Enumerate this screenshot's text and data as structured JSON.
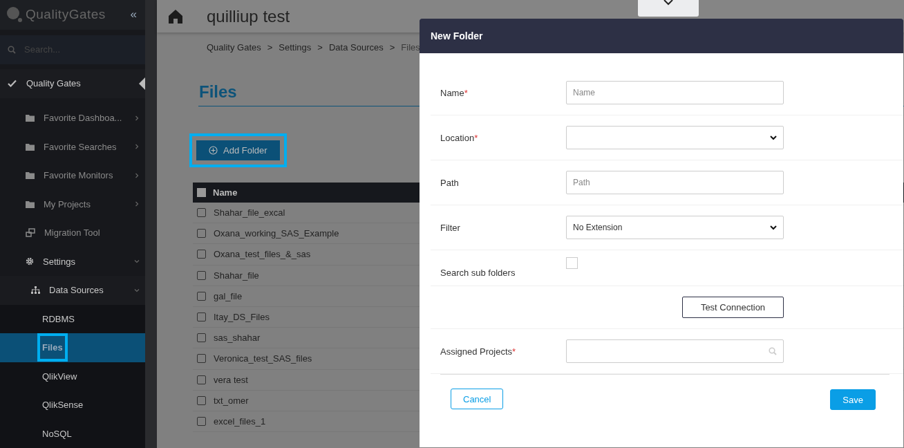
{
  "sidebar": {
    "logo": "QualityGates",
    "collapse": "«",
    "search": {
      "placeholder": "Search..."
    },
    "section": {
      "label": "Quality Gates",
      "expanded": true,
      "children": [
        {
          "label": "Favorite Dashboa...",
          "kind": "folder",
          "expanded": false
        },
        {
          "label": "Favorite Searches",
          "kind": "folder",
          "expanded": false
        },
        {
          "label": "Favorite Monitors",
          "kind": "folder",
          "expanded": false
        },
        {
          "label": "My Projects",
          "kind": "folder",
          "expanded": false
        },
        {
          "label": "Migration Tool",
          "kind": "tool"
        },
        {
          "label": "Settings",
          "kind": "settings",
          "expanded": true,
          "children": [
            {
              "label": "Data Sources",
              "kind": "hierarchy",
              "expanded": true,
              "children": [
                {
                  "label": "RDBMS",
                  "selected": false,
                  "highlighted": false
                },
                {
                  "label": "Files",
                  "selected": true,
                  "highlighted": true
                },
                {
                  "label": "QlikView",
                  "selected": false,
                  "highlighted": false
                },
                {
                  "label": "QlikSense",
                  "selected": false,
                  "highlighted": false
                },
                {
                  "label": "NoSQL",
                  "selected": false,
                  "highlighted": false
                }
              ]
            }
          ]
        }
      ]
    }
  },
  "header": {
    "title": "quilliup test"
  },
  "breadcrumb": {
    "separator": ">",
    "items": [
      "Quality Gates",
      "Settings",
      "Data Sources",
      "Files"
    ]
  },
  "page_title": "Files",
  "add_button": {
    "label": "Add Folder",
    "highlighted": true
  },
  "table": {
    "columns": [
      "Name"
    ],
    "header_checked": false,
    "rows": [
      {
        "name": "Shahar_file_excal",
        "checked": false
      },
      {
        "name": "Oxana_working_SAS_Example",
        "checked": false
      },
      {
        "name": "Oxana_test_files_&_sas",
        "checked": false
      },
      {
        "name": "Shahar_file",
        "checked": false
      },
      {
        "name": "gal_file",
        "checked": false
      },
      {
        "name": "Itay_DS_Files",
        "checked": false
      },
      {
        "name": "sas_shahar",
        "checked": false
      },
      {
        "name": "Veronica_test_SAS_files",
        "checked": false
      },
      {
        "name": "vera test",
        "checked": false
      },
      {
        "name": "txt_omer",
        "checked": false
      },
      {
        "name": "excel_files_1",
        "checked": false
      }
    ]
  },
  "modal": {
    "title": "New Folder",
    "required_mark": "*",
    "fields": [
      {
        "kind": "text",
        "label": "Name",
        "required": true,
        "placeholder": "Name"
      },
      {
        "kind": "select",
        "label": "Location",
        "required": true
      },
      {
        "kind": "text",
        "label": "Path",
        "required": false,
        "placeholder": "Path"
      },
      {
        "kind": "select",
        "label": "Filter",
        "required": false,
        "value": "No Extension"
      },
      {
        "kind": "checkbox",
        "label": "Search sub folders",
        "required": false,
        "checked": false
      },
      {
        "kind": "button",
        "label": "Test Connection"
      },
      {
        "kind": "search",
        "label": "Assigned Projects",
        "required": true
      }
    ],
    "buttons": [
      {
        "label": "Cancel",
        "kind": "secondary"
      },
      {
        "label": "Save",
        "kind": "primary"
      }
    ]
  }
}
